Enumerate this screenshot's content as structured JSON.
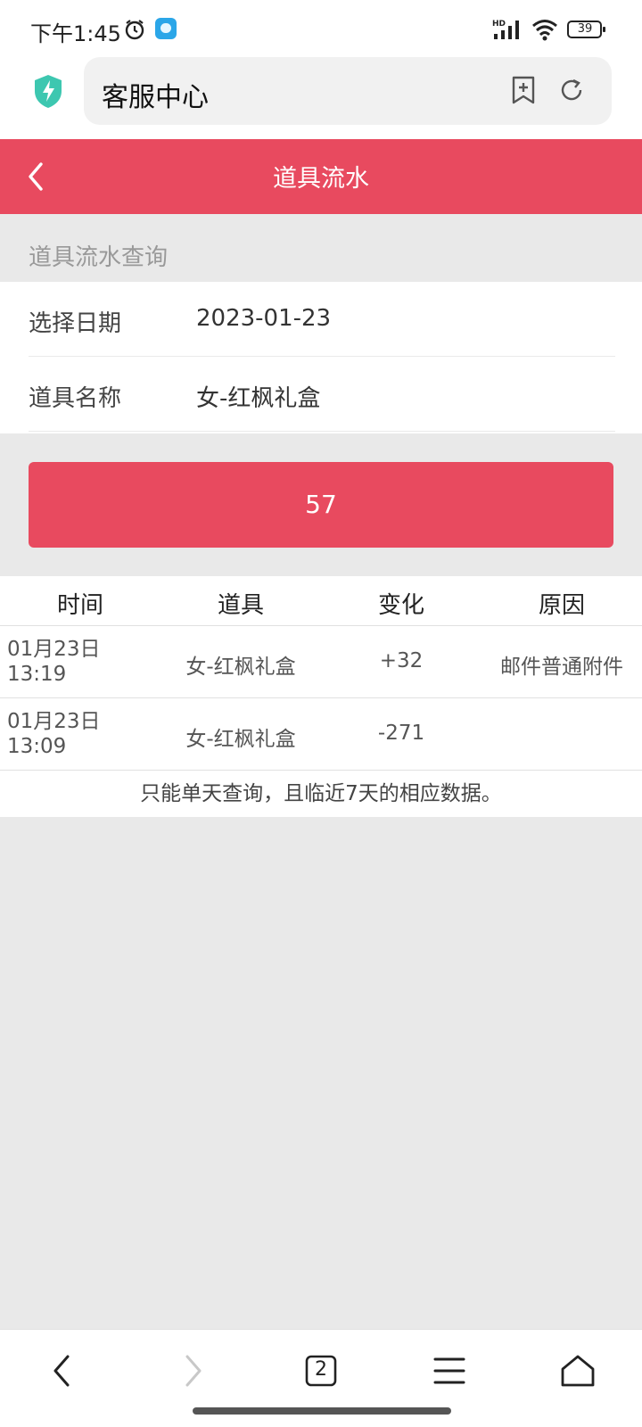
{
  "status_bar": {
    "time": "下午1:45",
    "battery": "39",
    "icons": [
      "alarm-icon",
      "app-notification-icon",
      "hd-signal-icon",
      "wifi-icon",
      "battery-icon"
    ]
  },
  "browser": {
    "url_title": "客服中心",
    "icons": [
      "shield-icon",
      "bookmark-add-icon",
      "refresh-icon"
    ]
  },
  "header": {
    "title": "道具流水"
  },
  "query": {
    "section_label": "道具流水查询",
    "date_label": "选择日期",
    "date_value": "2023-01-23",
    "item_label": "道具名称",
    "item_value": "女-红枫礼盒",
    "submit_label": "57"
  },
  "table": {
    "headers": [
      "时间",
      "道具",
      "变化",
      "原因"
    ],
    "rows": [
      {
        "date": "01月23日",
        "time": "13:19",
        "item": "女-红枫礼盒",
        "change": "+32",
        "reason": "邮件普通附件"
      },
      {
        "date": "01月23日",
        "time": "13:09",
        "item": "女-红枫礼盒",
        "change": "-271",
        "reason": ""
      }
    ],
    "note": "只能单天查询，且临近7天的相应数据。"
  },
  "bottom_nav": {
    "tab_count": "2",
    "icons": [
      "back-icon",
      "forward-icon",
      "tabs-icon",
      "menu-icon",
      "home-icon"
    ]
  },
  "colors": {
    "accent": "#e84a5f",
    "background": "#e9e9e9"
  }
}
